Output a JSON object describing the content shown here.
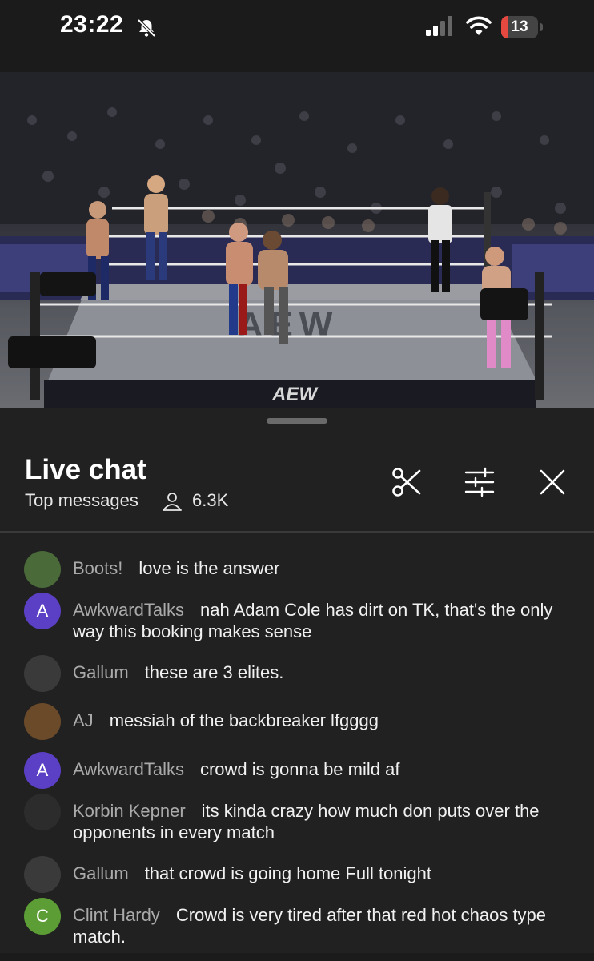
{
  "status_bar": {
    "time": "23:22",
    "battery": "13",
    "battery_level": 0.13
  },
  "chat": {
    "title": "Live chat",
    "mode": "Top messages",
    "viewers": "6.3K",
    "messages": [
      {
        "author": "Boots!",
        "text": "love is the answer",
        "avatar_letter": "",
        "avatar_color": "#4a6a3a"
      },
      {
        "author": "AwkwardTalks",
        "text": "nah Adam Cole has dirt on TK, that's the only way this booking makes sense",
        "avatar_letter": "A",
        "avatar_color": "#5b3fc4"
      },
      {
        "author": "Gallum",
        "text": "these are 3 elites.",
        "avatar_letter": "",
        "avatar_color": "#3a3a3a"
      },
      {
        "author": "AJ",
        "text": "messiah of the backbreaker lfgggg",
        "avatar_letter": "",
        "avatar_color": "#6b4a2a"
      },
      {
        "author": "AwkwardTalks",
        "text": "crowd is gonna be mild af",
        "avatar_letter": "A",
        "avatar_color": "#5b3fc4"
      },
      {
        "author": "Korbin Kepner",
        "text": "its kinda crazy how much don puts over the opponents in every match",
        "avatar_letter": "",
        "avatar_color": "#2c2c2c"
      },
      {
        "author": "Gallum",
        "text": "that crowd is going home Full tonight",
        "avatar_letter": "",
        "avatar_color": "#3a3a3a"
      },
      {
        "author": "Clint Hardy",
        "text": "Crowd is very tired after that red hot chaos type match.",
        "avatar_letter": "C",
        "avatar_color": "#5c9e35"
      }
    ]
  },
  "video": {
    "ring_logo": "AEW",
    "apron_logo": "AEW"
  },
  "icons": {
    "clip": "scissors-icon",
    "filter": "sliders-icon",
    "close": "close-icon",
    "viewers": "person-icon",
    "mute": "bell-slash-icon"
  }
}
